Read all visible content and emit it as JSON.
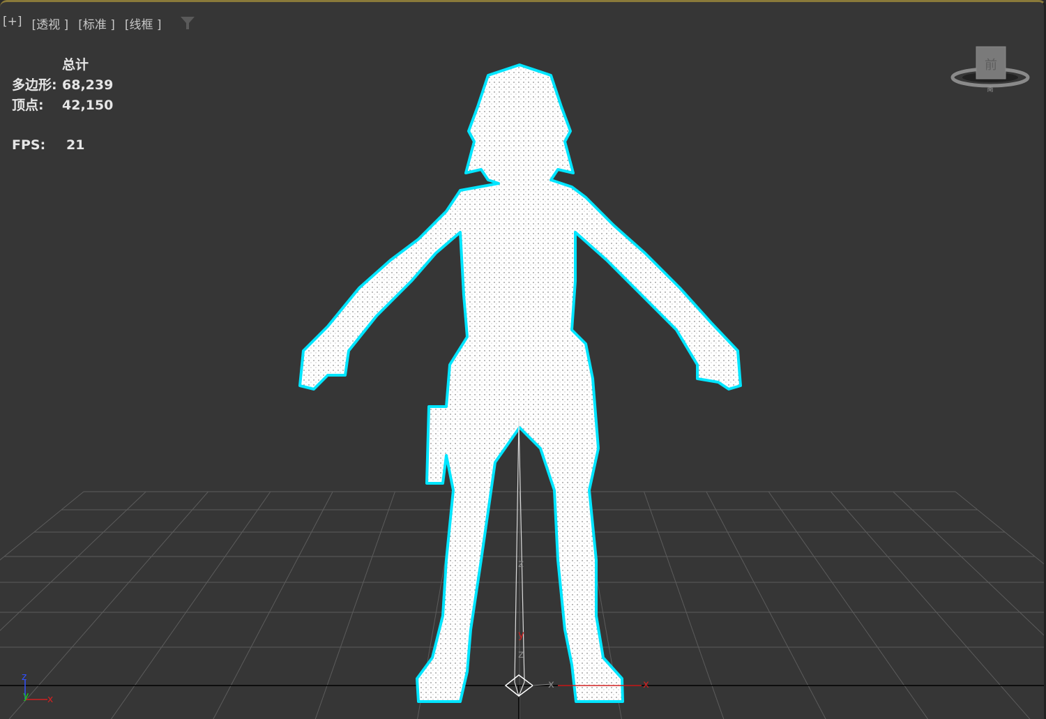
{
  "viewport_menu": {
    "plus": "[+]",
    "view": "[透视 ]",
    "shading_std": "[标准 ]",
    "shading_mode": "[线框 ]",
    "filter_icon": "filter-icon"
  },
  "stats": {
    "header": "总计",
    "polygons_label": "多边形:",
    "polygons_value": "68,239",
    "vertices_label": "顶点:",
    "vertices_value": "42,150",
    "fps_label": "FPS:",
    "fps_value": "21"
  },
  "viewcube": {
    "face": "前",
    "compass": "南"
  },
  "axis_tripod": {
    "z": "z",
    "y": "y",
    "x": "x"
  },
  "gizmo": {
    "x": "x",
    "y": "y",
    "z": "z"
  },
  "colors": {
    "background": "#363636",
    "wireframe": "#ffffff",
    "selection": "#00e5ff",
    "grid": "#5a5a5a",
    "x_axis": "#d02020",
    "y_axis": "#20c020",
    "z_axis": "#3050ff"
  }
}
